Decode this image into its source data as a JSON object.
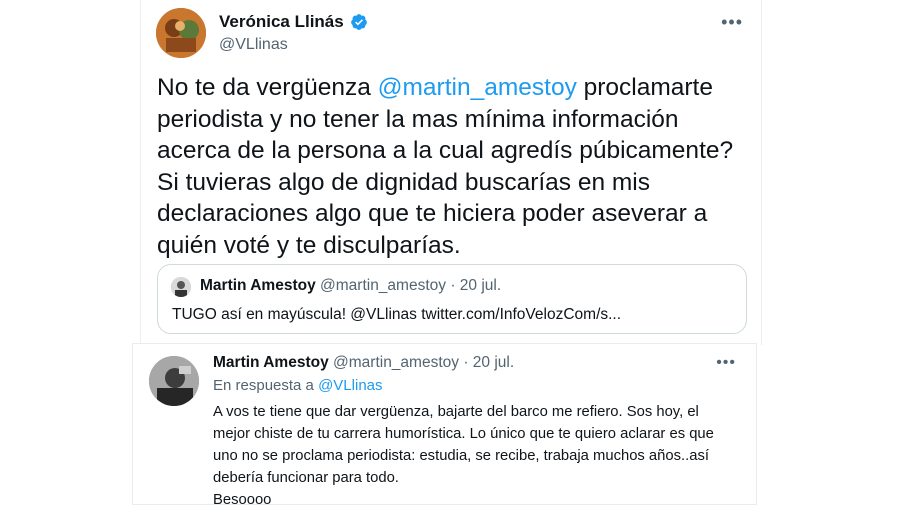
{
  "tweet": {
    "author_name": "Verónica Llinás",
    "handle": "@VLlinas",
    "more_label": "•••",
    "text_before": "No te da vergüenza ",
    "mention": "@martin_amestoy",
    "text_after": "  proclamarte periodista y no tener la mas mínima información acerca de la persona a la cual agredís púbicamente? Si tuvieras algo de dignidad buscarías en mis declaraciones algo que te hiciera poder aseverar a quién voté y te disculparías.",
    "quote": {
      "author_name": "Martin Amestoy",
      "meta": " @martin_amestoy · 20 jul.",
      "text": "TUGO así en mayúscula! @VLlinas twitter.com/InfoVelozCom/s..."
    }
  },
  "reply": {
    "author_name": "Martin Amestoy",
    "meta": " @martin_amestoy · 20 jul.",
    "more_label": "•••",
    "replying_prefix": "En respuesta a ",
    "replying_to": "@VLlinas",
    "text": "A vos te tiene que dar vergüenza, bajarte del barco me refiero. Sos hoy, el mejor chiste de tu carrera humorística. Lo único que te quiero aclarar es que uno no se proclama periodista: estudia, se recibe, trabaja muchos años..así debería funcionar para todo.",
    "text_last": "Besoooo"
  },
  "colors": {
    "link": "#1d9bf0",
    "secondary_text": "#536471",
    "border": "#cfd9de"
  }
}
